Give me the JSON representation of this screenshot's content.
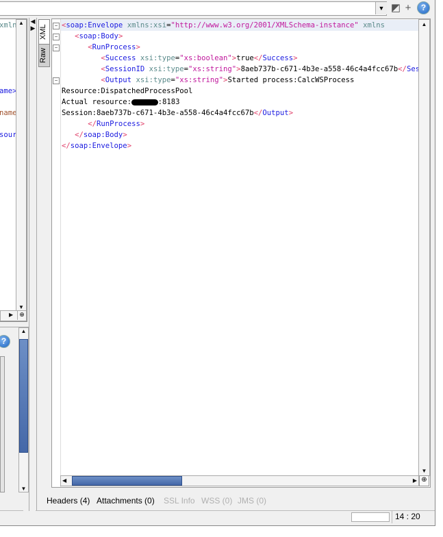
{
  "toolbar": {
    "combo_value": "",
    "dropdown_icon": "chevron-down-icon",
    "icons": [
      "format-icon",
      "plus-icon",
      "help-icon"
    ],
    "help_glyph": "?",
    "plus_glyph": "+"
  },
  "request_panel": {
    "fragments": [
      "xmlns",
      "ame>",
      "name",
      "sour"
    ]
  },
  "response": {
    "side_tabs": [
      "XML",
      "Raw"
    ],
    "lines": [
      [
        [
          "b",
          "<"
        ],
        [
          "t",
          "soap:Envelope"
        ],
        [
          "a",
          " xmlns:xsi"
        ],
        [
          "x",
          "="
        ],
        [
          "v",
          "\"http://www.w3.org/2001/XMLSchema-instance\""
        ],
        [
          "a",
          " xmlns"
        ]
      ],
      [
        [
          "x",
          "   "
        ],
        [
          "b",
          "<"
        ],
        [
          "t",
          "soap:Body"
        ],
        [
          "b",
          ">"
        ]
      ],
      [
        [
          "x",
          "      "
        ],
        [
          "b",
          "<"
        ],
        [
          "t",
          "RunProcess"
        ],
        [
          "b",
          ">"
        ]
      ],
      [
        [
          "x",
          "         "
        ],
        [
          "b",
          "<"
        ],
        [
          "t",
          "Success"
        ],
        [
          "a",
          " xsi:type"
        ],
        [
          "x",
          "="
        ],
        [
          "v",
          "\"xs:boolean\""
        ],
        [
          "b",
          ">"
        ],
        [
          "x",
          "true"
        ],
        [
          "b",
          "</"
        ],
        [
          "t",
          "Success"
        ],
        [
          "b",
          ">"
        ]
      ],
      [
        [
          "x",
          "         "
        ],
        [
          "b",
          "<"
        ],
        [
          "t",
          "SessionID"
        ],
        [
          "a",
          " xsi:type"
        ],
        [
          "x",
          "="
        ],
        [
          "v",
          "\"xs:string\""
        ],
        [
          "b",
          ">"
        ],
        [
          "x",
          "8aeb737b-c671-4b3e-a558-46c4a4fcc67b"
        ],
        [
          "b",
          "</"
        ],
        [
          "t",
          "SessionID"
        ],
        [
          "b",
          ">"
        ]
      ],
      [
        [
          "x",
          "         "
        ],
        [
          "b",
          "<"
        ],
        [
          "t",
          "Output"
        ],
        [
          "a",
          " xsi:type"
        ],
        [
          "x",
          "="
        ],
        [
          "v",
          "\"xs:string\""
        ],
        [
          "b",
          ">"
        ],
        [
          "x",
          "Started process:CalcWSProcess"
        ]
      ],
      [
        [
          "x",
          "Resource:DispatchedProcessPool"
        ]
      ],
      [
        [
          "x",
          "Actual resource:"
        ],
        [
          "r",
          "●●●●●●●●"
        ],
        [
          "x",
          ":8183"
        ]
      ],
      [
        [
          "x",
          "Session:8aeb737b-c671-4b3e-a558-46c4a4fcc67b"
        ],
        [
          "b",
          "</"
        ],
        [
          "t",
          "Output"
        ],
        [
          "b",
          ">"
        ]
      ],
      [
        [
          "x",
          "      "
        ],
        [
          "b",
          "</"
        ],
        [
          "t",
          "RunProcess"
        ],
        [
          "b",
          ">"
        ]
      ],
      [
        [
          "x",
          "   "
        ],
        [
          "b",
          "</"
        ],
        [
          "t",
          "soap:Body"
        ],
        [
          "b",
          ">"
        ]
      ],
      [
        [
          "b",
          "</"
        ],
        [
          "t",
          "soap:Envelope"
        ],
        [
          "b",
          ">"
        ]
      ]
    ],
    "fold_lines": [
      0,
      1,
      2,
      5
    ]
  },
  "bottom_tabs": [
    {
      "label": "Headers (4)",
      "enabled": true
    },
    {
      "label": "Attachments (0)",
      "enabled": true
    },
    {
      "label": "SSL Info",
      "enabled": false
    },
    {
      "label": "WSS (0)",
      "enabled": false
    },
    {
      "label": "JMS (0)",
      "enabled": false
    }
  ],
  "status": {
    "position": "14 : 20"
  }
}
